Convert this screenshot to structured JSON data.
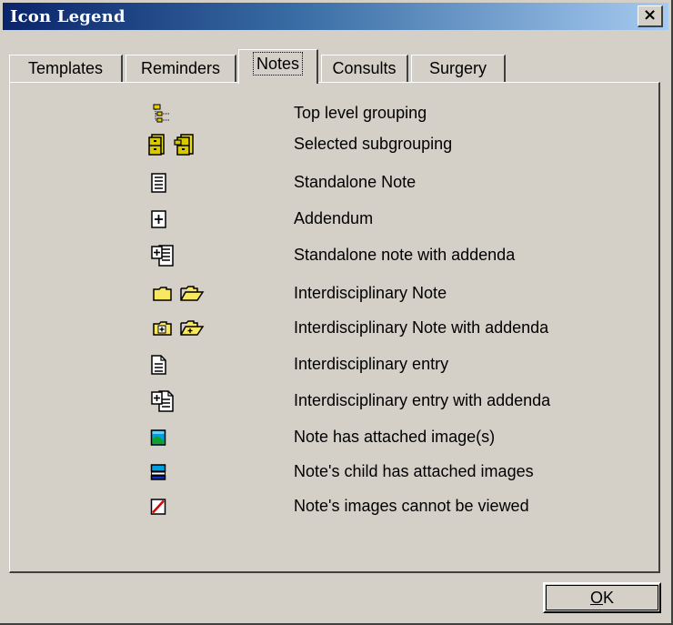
{
  "window": {
    "title": "Icon Legend",
    "close_label": "×"
  },
  "tabs": [
    {
      "label": "Templates",
      "active": false
    },
    {
      "label": "Reminders",
      "active": false
    },
    {
      "label": "Notes",
      "active": true
    },
    {
      "label": "Consults",
      "active": false
    },
    {
      "label": "Surgery",
      "active": false
    }
  ],
  "legend": [
    {
      "icons": [
        "tree-grouping-icon"
      ],
      "label": "Top level grouping"
    },
    {
      "icons": [
        "cabinet-icon",
        "cabinet-open-icon"
      ],
      "label": "Selected subgrouping"
    },
    {
      "icons": [
        "note-icon"
      ],
      "label": "Standalone Note"
    },
    {
      "icons": [
        "addendum-icon"
      ],
      "label": "Addendum"
    },
    {
      "icons": [
        "note-with-addenda-icon"
      ],
      "label": "Standalone note with addenda"
    },
    {
      "icons": [
        "folder-closed-icon",
        "folder-open-icon"
      ],
      "label": "Interdisciplinary Note"
    },
    {
      "icons": [
        "folder-plus-closed-icon",
        "folder-plus-open-icon"
      ],
      "label": "Interdisciplinary Note with addenda"
    },
    {
      "icons": [
        "entry-icon"
      ],
      "label": "Interdisciplinary entry"
    },
    {
      "icons": [
        "entry-with-addenda-icon"
      ],
      "label": "Interdisciplinary entry with addenda"
    },
    {
      "icons": [
        "attached-image-icon"
      ],
      "label": "Note has attached image(s)"
    },
    {
      "icons": [
        "child-attached-images-icon"
      ],
      "label": "Note's child has attached images"
    },
    {
      "icons": [
        "image-not-viewable-icon"
      ],
      "label": "Note's images cannot be viewed"
    }
  ],
  "buttons": {
    "ok_mnemonic": "O",
    "ok_rest": "K"
  }
}
